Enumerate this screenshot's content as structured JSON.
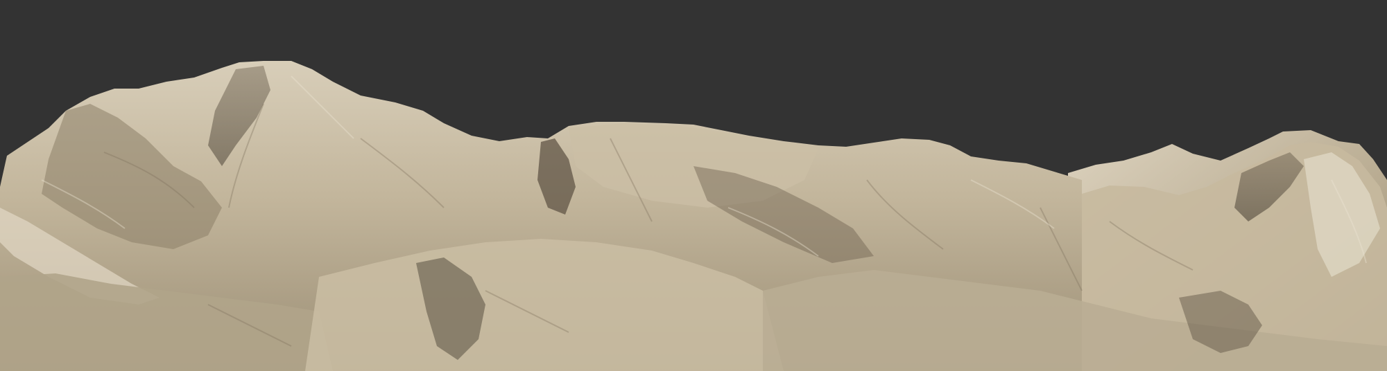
{
  "scene": {
    "subject": "terrain-render",
    "colors": {
      "background": "#333333",
      "rock_light": "#d8ceb9",
      "rock_mid": "#b3a68c",
      "rock_shadow": "#6e6250",
      "rock_deep": "#3f372c"
    }
  }
}
